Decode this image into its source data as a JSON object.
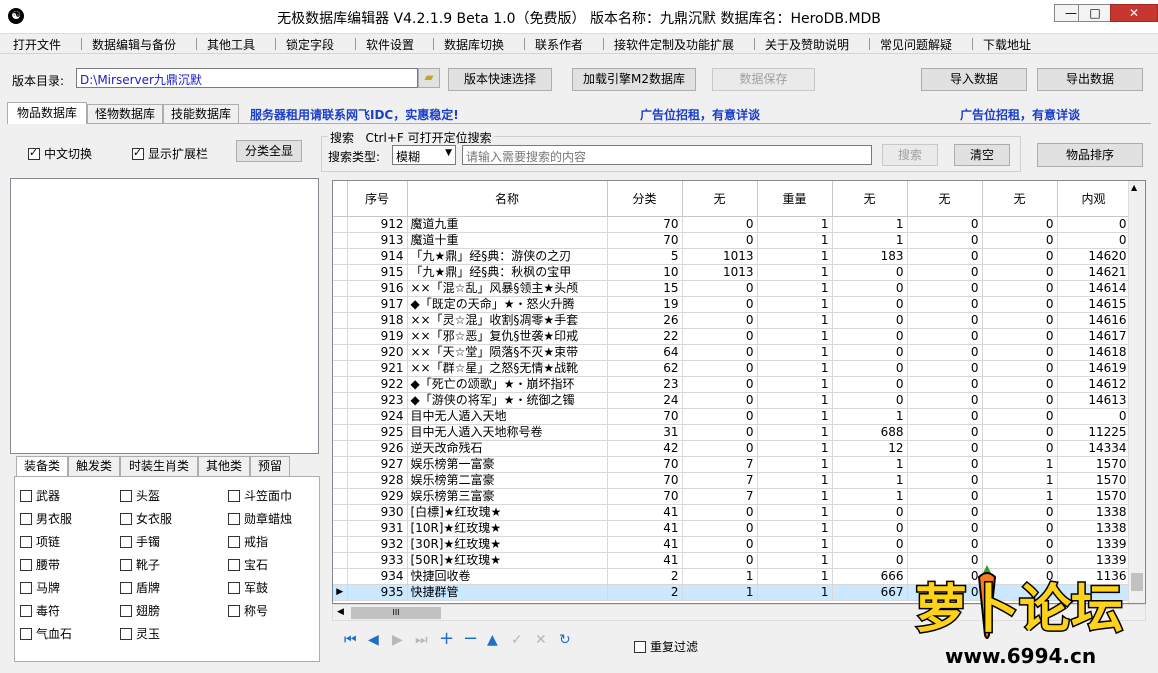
{
  "window": {
    "title": "无极数据库编辑器 V4.2.1.9    Beta 1.0（免费版）    版本名称：九鼎沉默     数据库名：HeroDB.MDB",
    "min": "—",
    "max": "□",
    "close": "✕"
  },
  "menu": [
    "打开文件",
    "数据编辑与备份",
    "其他工具",
    "锁定字段",
    "软件设置",
    "数据库切换",
    "联系作者",
    "接软件定制及功能扩展",
    "关于及赞助说明",
    "常见问题解疑",
    "下载地址"
  ],
  "toolbar": {
    "dir_label": "版本目录:",
    "dir_value": "D:\\Mirserver九鼎沉默",
    "quick_select": "版本快速选择",
    "load_m2": "加载引擎M2数据库",
    "save": "数据保存",
    "import": "导入数据",
    "export": "导出数据"
  },
  "tabs": [
    "物品数据库",
    "怪物数据库",
    "技能数据库"
  ],
  "ads": {
    "a1": "服务器租用请联系网飞IDC，实惠稳定!",
    "a2": "广告位招租，有意详谈",
    "a3": "广告位招租，有意详谈"
  },
  "options": {
    "chinese": "中文切换",
    "show_ext": "显示扩展栏",
    "show_all": "分类全显"
  },
  "search": {
    "title": "搜索",
    "hint": "Ctrl+F 可打开定位搜索",
    "type_label": "搜索类型:",
    "type_value": "模糊",
    "placeholder": "请输入需要搜索的内容",
    "search_btn": "搜索",
    "clear_btn": "清空",
    "sort_btn": "物品排序"
  },
  "grid": {
    "columns": [
      "序号",
      "名称",
      "分类",
      "无",
      "重量",
      "无",
      "无",
      "无",
      "内观"
    ],
    "rows": [
      [
        "912",
        "魔道九重",
        "70",
        "0",
        "1",
        "1",
        "0",
        "0",
        "0"
      ],
      [
        "913",
        "魔道十重",
        "70",
        "0",
        "1",
        "1",
        "0",
        "0",
        "0"
      ],
      [
        "914",
        "「九★鼎」经§典：游侠の之刃",
        "5",
        "1013",
        "1",
        "183",
        "0",
        "0",
        "14620"
      ],
      [
        "915",
        "「九★鼎」经§典：秋枫の宝甲",
        "10",
        "1013",
        "1",
        "0",
        "0",
        "0",
        "14621"
      ],
      [
        "916",
        "××「混☆乱」风暴§领主★头颅",
        "15",
        "0",
        "1",
        "0",
        "0",
        "0",
        "14614"
      ],
      [
        "917",
        "◆「既定の天命」★・怒火升腾",
        "19",
        "0",
        "1",
        "0",
        "0",
        "0",
        "14615"
      ],
      [
        "918",
        "××「灵☆混」收割§凋零★手套",
        "26",
        "0",
        "1",
        "0",
        "0",
        "0",
        "14616"
      ],
      [
        "919",
        "××「邪☆恶」复仇§世袭★印戒",
        "22",
        "0",
        "1",
        "0",
        "0",
        "0",
        "14617"
      ],
      [
        "920",
        "××「天☆堂」陨落§不灭★束带",
        "64",
        "0",
        "1",
        "0",
        "0",
        "0",
        "14618"
      ],
      [
        "921",
        "××「群☆星」之怒§无情★战靴",
        "62",
        "0",
        "1",
        "0",
        "0",
        "0",
        "14619"
      ],
      [
        "922",
        "◆「死亡の颂歌」★・崩坏指环",
        "23",
        "0",
        "1",
        "0",
        "0",
        "0",
        "14612"
      ],
      [
        "923",
        "◆「游侠の将军」★・统御之镯",
        "24",
        "0",
        "1",
        "0",
        "0",
        "0",
        "14613"
      ],
      [
        "924",
        "目中无人遁入天地",
        "70",
        "0",
        "1",
        "1",
        "0",
        "0",
        "0"
      ],
      [
        "925",
        "目中无人遁入天地称号卷",
        "31",
        "0",
        "1",
        "688",
        "0",
        "0",
        "11225"
      ],
      [
        "926",
        "逆天改命残石",
        "42",
        "0",
        "1",
        "12",
        "0",
        "0",
        "14334"
      ],
      [
        "927",
        "娱乐榜第一富豪",
        "70",
        "7",
        "1",
        "1",
        "0",
        "1",
        "1570"
      ],
      [
        "928",
        "娱乐榜第二富豪",
        "70",
        "7",
        "1",
        "1",
        "0",
        "1",
        "1570"
      ],
      [
        "929",
        "娱乐榜第三富豪",
        "70",
        "7",
        "1",
        "1",
        "0",
        "1",
        "1570"
      ],
      [
        "930",
        "[白標]★红玫瑰★",
        "41",
        "0",
        "1",
        "0",
        "0",
        "0",
        "1338"
      ],
      [
        "931",
        "[10R]★红玫瑰★",
        "41",
        "0",
        "1",
        "0",
        "0",
        "0",
        "1338"
      ],
      [
        "932",
        "[30R]★红玫瑰★",
        "41",
        "0",
        "1",
        "0",
        "0",
        "0",
        "1339"
      ],
      [
        "933",
        "[50R]★红玫瑰★",
        "41",
        "0",
        "1",
        "0",
        "0",
        "0",
        "1339"
      ],
      [
        "934",
        "快捷回收卷",
        "2",
        "1",
        "1",
        "666",
        "0",
        "0",
        "1136"
      ],
      [
        "935",
        "快捷群管",
        "2",
        "1",
        "1",
        "667",
        "0",
        "0",
        ""
      ]
    ]
  },
  "category_tabs": [
    "装备类",
    "触发类",
    "时装生肖类",
    "其他类",
    "预留"
  ],
  "categories": [
    "武器",
    "头盔",
    "斗笠面巾",
    "男衣服",
    "女衣服",
    "勋章蜡烛",
    "项链",
    "手镯",
    "戒指",
    "腰带",
    "靴子",
    "宝石",
    "马牌",
    "盾牌",
    "军鼓",
    "毒符",
    "翅膀",
    "称号",
    "气血石",
    "灵玉"
  ],
  "bottom": {
    "repeat_filter": "重复过滤",
    "hscroll_grip": "III"
  },
  "watermark": {
    "name": "萝卜论坛",
    "url": "www.6994.cn"
  }
}
